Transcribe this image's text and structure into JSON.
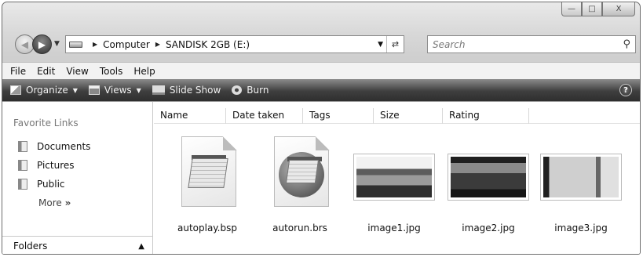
{
  "window": {
    "caption_buttons": {
      "minimize": "—",
      "maximize": "□",
      "close": "X"
    }
  },
  "address": {
    "crumbs": [
      "Computer",
      "SANDISK 2GB (E:)"
    ]
  },
  "search": {
    "placeholder": "Search"
  },
  "menubar": [
    "File",
    "Edit",
    "View",
    "Tools",
    "Help"
  ],
  "commands": {
    "organize": "Organize",
    "views": "Views",
    "slideshow": "Slide Show",
    "burn": "Burn",
    "help": "?"
  },
  "nav": {
    "favorite_title": "Favorite Links",
    "items": [
      "Documents",
      "Pictures",
      "Public"
    ],
    "more": "More",
    "more_glyph": "»",
    "folders": "Folders"
  },
  "columns": [
    "Name",
    "Date taken",
    "Tags",
    "Size",
    "Rating"
  ],
  "files": [
    {
      "name": "autoplay.bsp",
      "icon": "notepad-document-icon"
    },
    {
      "name": "autorun.brs",
      "icon": "script-document-icon"
    },
    {
      "name": "image1.jpg",
      "icon": "image-thumbnail"
    },
    {
      "name": "image2.jpg",
      "icon": "image-thumbnail"
    },
    {
      "name": "image3.jpg",
      "icon": "image-thumbnail"
    }
  ]
}
